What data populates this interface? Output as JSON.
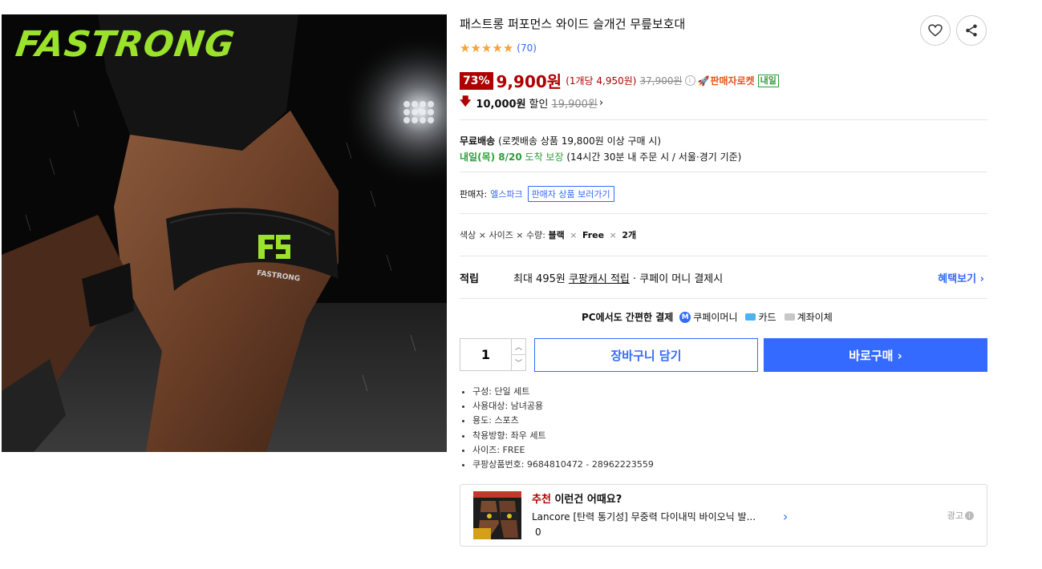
{
  "product_image": {
    "brand_logo": "FASTRONG",
    "band_text": "FASTRONG"
  },
  "product": {
    "title": "패스트롱 퍼포먼스 와이드 슬개건 무릎보호대",
    "rating": {
      "stars": 5,
      "review_count": "(70)"
    },
    "price": {
      "discount_rate": "73%",
      "sale_price": "9,900원",
      "unit_price": "(1개당 4,950원)",
      "original_price": "37,900원",
      "info_icon": "ⓘ",
      "rocket_label": "판매자로켓",
      "arrival_badge": "내일"
    },
    "coupon": {
      "amount": "10,000원",
      "text": "할인",
      "original": "19,900원",
      "arrow": "›"
    }
  },
  "shipping": {
    "free_label": "무료배송",
    "free_detail": "(로켓배송 상품 19,800원 이상 구매 시)",
    "arrival_date": "내일(목) 8/20",
    "arrival_text": "도착 보장",
    "arrival_detail": "(14시간 30분 내 주문 시 / 서울⋅경기 기준)"
  },
  "seller": {
    "label": "판매자:",
    "name": "엘스파크",
    "link_label": "판매자 상품 보러가기"
  },
  "options": {
    "labels": "색상 × 사이즈 × 수량:",
    "color": "블랙",
    "size": "Free",
    "quantity": "2개",
    "sep": "×"
  },
  "reward": {
    "label": "적립",
    "prefix": "최대 495원",
    "cash_link": "쿠팡캐시 적립",
    "suffix": "· 쿠페이 머니 결제시",
    "link_label": "혜택보기 ›"
  },
  "payment": {
    "title": "PC에서도 간편한 결제",
    "methods": [
      "쿠페이머니",
      "카드",
      "계좌이체"
    ]
  },
  "purchase": {
    "quantity": "1",
    "cart_label": "장바구니 담기",
    "buy_label": "바로구매 ›"
  },
  "specs": [
    "구성: 단일 세트",
    "사용대상: 남녀공용",
    "용도: 스포츠",
    "착용방향: 좌우 세트",
    "사이즈: FREE",
    "쿠팡상품번호: 9684810472 - 28962223559"
  ],
  "recommend": {
    "title_red": "추천",
    "title": "이런건 어때요?",
    "product": "Lancore [탄력 통기성] 무중력 다이내믹 바이오닉 발...",
    "price": "0",
    "ad_label": "광고"
  },
  "colors": {
    "accent_blue": "#346aff",
    "price_red": "#ae0000",
    "star_orange": "#f8a23b",
    "green": "#2f9d3a",
    "brand_green": "#9be22a"
  },
  "icons": [
    "heart-icon",
    "share-icon",
    "star-icon",
    "info-icon",
    "rocket-icon",
    "down-arrow-icon",
    "chevron-right-icon",
    "kpay-icon",
    "card-icon",
    "bank-icon",
    "stepper-up-icon",
    "stepper-down-icon"
  ]
}
